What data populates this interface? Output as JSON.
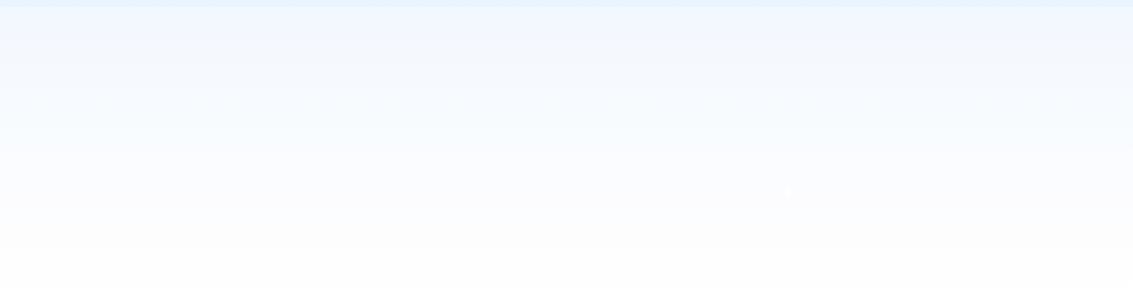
{
  "background": {
    "top_strip_color": "#eaf4fe",
    "gradient_top_color": "#f2f7fe",
    "gradient_bottom_color": "#ffffff"
  },
  "decorations": {
    "sparkle_icon": "sparkle-icon",
    "sparkle_color": "#ffffff"
  }
}
